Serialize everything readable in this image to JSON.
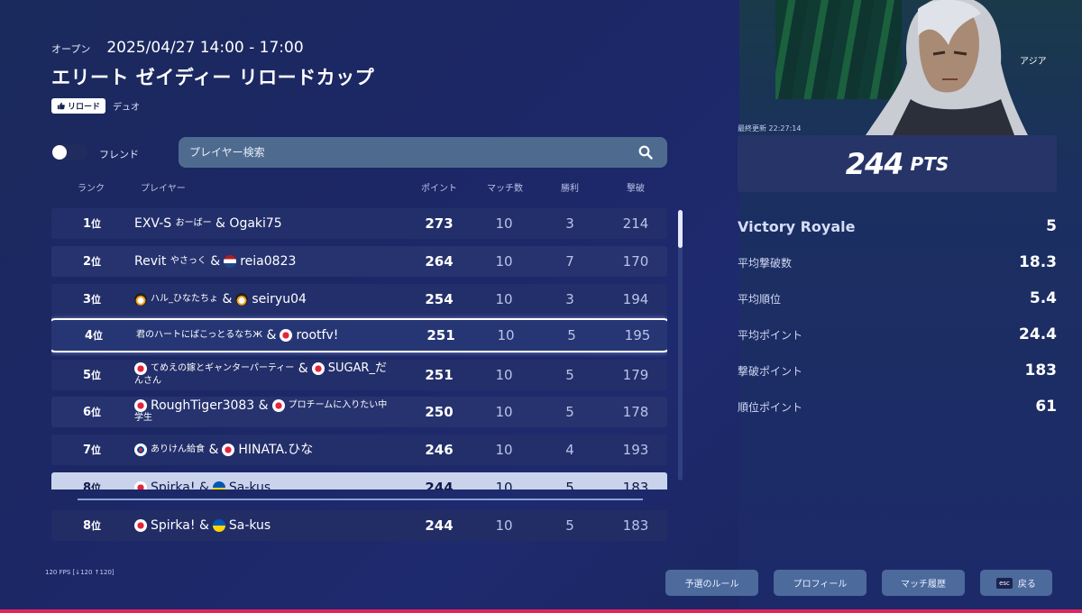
{
  "header": {
    "status": "オープン",
    "datetime": "2025/04/27 14:00 - 17:00",
    "title": "エリート ゼイディー リロードカップ",
    "tag": "リロード",
    "mode": "デュオ"
  },
  "filters": {
    "friends_label": "フレンド",
    "friends_on": false,
    "search_placeholder": "プレイヤー検索"
  },
  "table": {
    "headers": {
      "rank": "ランク",
      "player": "プレイヤー",
      "points": "ポイント",
      "matches": "マッチ数",
      "wins": "勝利",
      "kills": "撃破"
    },
    "rank_suffix": "位",
    "rows": [
      {
        "rank": "1",
        "p1": "EXV-S",
        "p1_sub": "おーばー",
        "sep": "&",
        "p2": "Ogaki75",
        "points": "273",
        "matches": "10",
        "wins": "3",
        "kills": "214"
      },
      {
        "rank": "2",
        "p1": "Revit",
        "p1_sub": "やさっく",
        "sep": "&",
        "p2": "reia0823",
        "points": "264",
        "matches": "10",
        "wins": "7",
        "kills": "170"
      },
      {
        "rank": "3",
        "p1": "ハル_ひなたちょ",
        "sep": "&",
        "p2": "seiryu04",
        "points": "254",
        "matches": "10",
        "wins": "3",
        "kills": "194"
      },
      {
        "rank": "4",
        "p1": "君のハートにばこっとるなちЖ",
        "sep": "&",
        "p2": "rootfv!",
        "points": "251",
        "matches": "10",
        "wins": "5",
        "kills": "195"
      },
      {
        "rank": "5",
        "p1": "てめえの嫁とギャンターパーティー",
        "sep": "&",
        "p2": "SUGAR_だ",
        "p2_cont": "んさん",
        "points": "251",
        "matches": "10",
        "wins": "5",
        "kills": "179"
      },
      {
        "rank": "6",
        "p1": "RoughTiger3083",
        "sep": "&",
        "p2": "プロチームに入りたい中",
        "p2_cont": "学生",
        "points": "250",
        "matches": "10",
        "wins": "5",
        "kills": "178"
      },
      {
        "rank": "7",
        "p1": "ありけん給食",
        "sep": "&",
        "p2": "HINATA.ひな",
        "points": "246",
        "matches": "10",
        "wins": "4",
        "kills": "193"
      },
      {
        "rank": "8",
        "p1": "Spirka!",
        "sep": "&",
        "p2": "Sa-kus",
        "points": "244",
        "matches": "10",
        "wins": "5",
        "kills": "183"
      }
    ],
    "own_row": {
      "rank": "8",
      "p1": "Spirka!",
      "sep": "&",
      "p2": "Sa-kus",
      "points": "244",
      "matches": "10",
      "wins": "5",
      "kills": "183"
    }
  },
  "fps": "120 FPS [↓120 ↑120]",
  "profile": {
    "region": "アジア",
    "last_updated_label": "最終更新",
    "last_updated": "22:27:14",
    "points": "244",
    "points_unit": "PTS",
    "stats": [
      {
        "label": "Victory Royale",
        "value": "5"
      },
      {
        "label": "平均撃破数",
        "value": "18.3"
      },
      {
        "label": "平均順位",
        "value": "5.4"
      },
      {
        "label": "平均ポイント",
        "value": "24.4"
      },
      {
        "label": "撃破ポイント",
        "value": "183"
      },
      {
        "label": "順位ポイント",
        "value": "61"
      }
    ]
  },
  "footer": {
    "rules": "予選のルール",
    "profile": "プロフィール",
    "history": "マッチ履歴",
    "back_key": "esc",
    "back": "戻る"
  },
  "colors": {
    "background": "#1c2766",
    "accent_bar": "#e0245e",
    "button": "#4c6a9c"
  }
}
